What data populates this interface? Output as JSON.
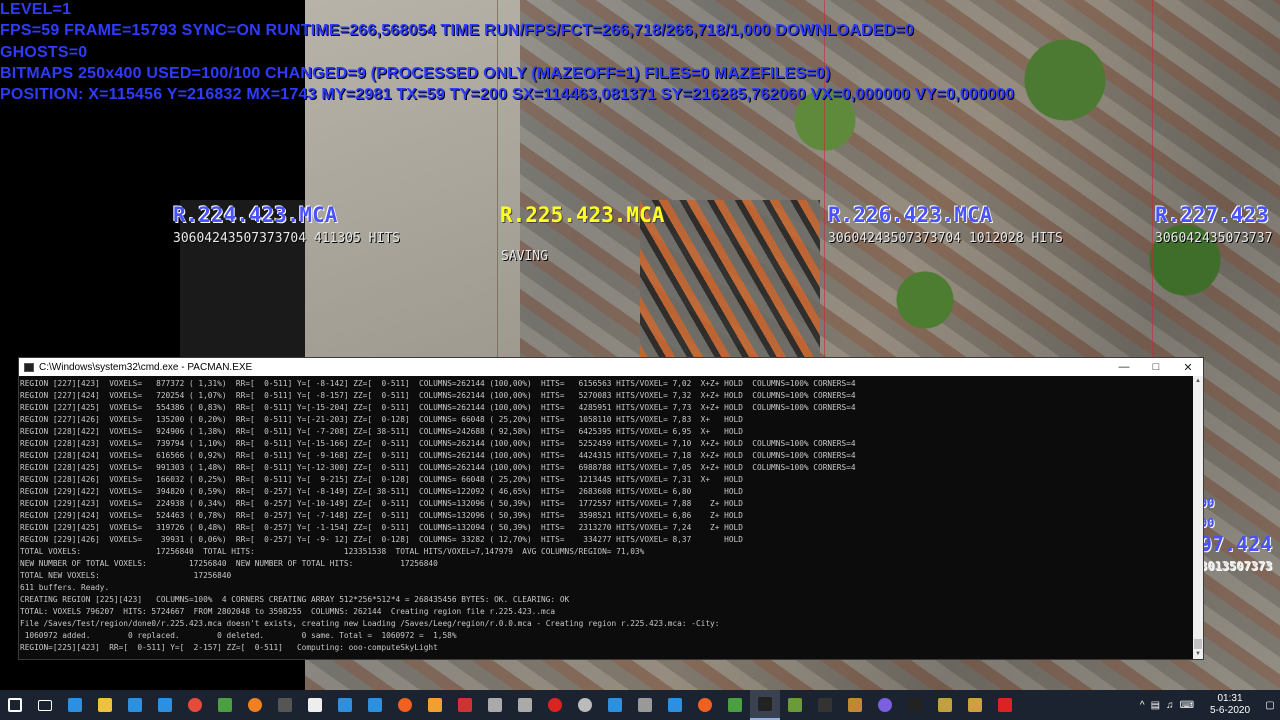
{
  "overlay": {
    "lines": [
      "LEVEL=1",
      "FPS=59 FRAME=15793 SYNC=ON RUNTIME=266,568054 TIME RUN/FPS/FCT=266,718/266,718/1,000 DOWNLOADED=0",
      "GHOSTS=0",
      "BITMAPS 250x400 USED=100/100 CHANGED=9 (PROCESSED ONLY (MAZEOFF=1) FILES=0 MAZEFILES=0)",
      "POSITION: X=115456 Y=216832 MX=1743 MY=2981 TX=59 TY=200 SX=114463,081371 SY=216285,762060 VX=0,000000 VY=0,000000"
    ],
    "color": "#2f3bff"
  },
  "regions": [
    {
      "name": "R.224.423.MCA",
      "sub": "30604243507373704  411305 HITS",
      "status": ""
    },
    {
      "name": "R.225.423.MCA",
      "sub": "",
      "status": "SAVING"
    },
    {
      "name": "R.226.423.MCA",
      "sub": "30604243507373704 1012028 HITS",
      "status": ""
    },
    {
      "name": "R.227.423",
      "sub": "306042435073737",
      "status": ""
    }
  ],
  "edge_fragments": [
    "00",
    "00",
    "97.424",
    "3013507373"
  ],
  "console": {
    "title": "C:\\Windows\\system32\\cmd.exe - PACMAN.EXE",
    "lines": [
      "REGION [227][423]  VOXELS=   877372 ( 1,31%)  RR=[  0-511] Y=[ -8-142] ZZ=[  0-511]  COLUMNS=262144 (100,00%)  HITS=   6156563 HITS/VOXEL= 7,02  X+Z+ HOLD  COLUMNS=100% CORNERS=4",
      "REGION [227][424]  VOXELS=   720254 ( 1,07%)  RR=[  0-511] Y=[ -8-157] ZZ=[  0-511]  COLUMNS=262144 (100,00%)  HITS=   5270083 HITS/VOXEL= 7,32  X+Z+ HOLD  COLUMNS=100% CORNERS=4",
      "REGION [227][425]  VOXELS=   554386 ( 0,83%)  RR=[  0-511] Y=[-15-204] ZZ=[  0-511]  COLUMNS=262144 (100,00%)  HITS=   4285951 HITS/VOXEL= 7,73  X+Z+ HOLD  COLUMNS=100% CORNERS=4",
      "REGION [227][426]  VOXELS=   135200 ( 0,20%)  RR=[  0-511] Y=[-21-203] ZZ=[  0-128]  COLUMNS= 66048 ( 25,20%)  HITS=   1058110 HITS/VOXEL= 7,83  X+   HOLD",
      "REGION [228][422]  VOXELS=   924906 ( 1,38%)  RR=[  0-511] Y=[ -7-208] ZZ=[ 38-511]  COLUMNS=242688 ( 92,58%)  HITS=   6425395 HITS/VOXEL= 6,95  X+   HOLD",
      "REGION [228][423]  VOXELS=   739794 ( 1,10%)  RR=[  0-511] Y=[-15-166] ZZ=[  0-511]  COLUMNS=262144 (100,00%)  HITS=   5252459 HITS/VOXEL= 7,10  X+Z+ HOLD  COLUMNS=100% CORNERS=4",
      "REGION [228][424]  VOXELS=   616566 ( 0,92%)  RR=[  0-511] Y=[ -9-168] ZZ=[  0-511]  COLUMNS=262144 (100,00%)  HITS=   4424315 HITS/VOXEL= 7,18  X+Z+ HOLD  COLUMNS=100% CORNERS=4",
      "REGION [228][425]  VOXELS=   991303 ( 1,48%)  RR=[  0-511] Y=[-12-300] ZZ=[  0-511]  COLUMNS=262144 (100,00%)  HITS=   6988788 HITS/VOXEL= 7,05  X+Z+ HOLD  COLUMNS=100% CORNERS=4",
      "REGION [228][426]  VOXELS=   166032 ( 0,25%)  RR=[  0-511] Y=[  9-215] ZZ=[  0-128]  COLUMNS= 66048 ( 25,20%)  HITS=   1213445 HITS/VOXEL= 7,31  X+   HOLD",
      "REGION [229][422]  VOXELS=   394820 ( 0,59%)  RR=[  0-257] Y=[ -8-149] ZZ=[ 38-511]  COLUMNS=122092 ( 46,65%)  HITS=   2683608 HITS/VOXEL= 6,80       HOLD",
      "REGION [229][423]  VOXELS=   224938 ( 0,34%)  RR=[  0-257] Y=[-10-149] ZZ=[  0-511]  COLUMNS=132096 ( 50,39%)  HITS=   1772557 HITS/VOXEL= 7,88    Z+ HOLD",
      "REGION [229][424]  VOXELS=   524463 ( 0,78%)  RR=[  0-257] Y=[ -7-148] ZZ=[  0-511]  COLUMNS=132096 ( 50,39%)  HITS=   3598521 HITS/VOXEL= 6,86    Z+ HOLD",
      "REGION [229][425]  VOXELS=   319726 ( 0,48%)  RR=[  0-257] Y=[ -1-154] ZZ=[  0-511]  COLUMNS=132094 ( 50,39%)  HITS=   2313270 HITS/VOXEL= 7,24    Z+ HOLD",
      "REGION [229][426]  VOXELS=    39931 ( 0,06%)  RR=[  0-257] Y=[ -9- 12] ZZ=[  0-128]  COLUMNS= 33282 ( 12,70%)  HITS=    334277 HITS/VOXEL= 8,37       HOLD",
      "TOTAL VOXELS:                17256840  TOTAL HITS:                   123351538  TOTAL HITS/VOXEL=7,147979  AVG COLUMNS/REGION= 71,03%",
      "NEW NUMBER OF TOTAL VOXELS:         17256840  NEW NUMBER OF TOTAL HITS:          17256840",
      "TOTAL NEW VOXELS:                    17256840",
      "611 buffers. Ready.",
      "CREATING REGION [225][423]   COLUMNS=100%  4 CORNERS CREATING ARRAY 512*256*512*4 = 268435456 BYTES: OK. CLEARING: OK",
      "TOTAL: VOXELS 796207  HITS: 5724667  FROM 2802048 to 3598255  COLUMNS: 262144  Creating region file r.225.423..mca",
      "File /Saves/Test/region/done0/r.225.423.mca doesn't exists, creating new Loading /Saves/Leeg/region/r.0.0.mca - Creating region r.225.423.mca: -City:",
      " 1060972 added.        0 replaced.        0 deleted.        0 same. Total =  1060972 =  1,58%",
      "REGION=[225][423]  RR=[  0-511] Y=[  2-157] ZZ=[  0-511]   Computing: ooo-computeSkyLight"
    ]
  },
  "taskbar": {
    "icons": [
      "windows-start-icon",
      "task-view-icon",
      "edge-icon",
      "file-explorer-icon",
      "store-icon",
      "mail-icon",
      "chrome-icon",
      "notepad-icon",
      "vlc-icon",
      "terminal-icon",
      "github-icon",
      "edge-blue-icon",
      "photos-icon",
      "firefox-icon",
      "paint-icon",
      "tool-icon",
      "steam-icon",
      "settings-icon",
      "record-icon",
      "obs-icon",
      "globe-icon",
      "calculator-icon",
      "maps-icon",
      "ubuntu-icon",
      "sound-icon",
      "cmd-icon",
      "minecraft-icon",
      "console-icon",
      "archive-icon",
      "discord-icon",
      "terminal2-icon",
      "cube-icon",
      "box-icon",
      "filezilla-icon",
      "vs-icon",
      "window-icon"
    ],
    "colors": [
      "#ffffff",
      "#ffffff",
      "#2d8fe0",
      "#f0c040",
      "#2d8fe0",
      "#2d8fe0",
      "#e84a3a",
      "#4aa040",
      "#f08020",
      "#555555",
      "#eeeeee",
      "#2d8fe0",
      "#2d8fe0",
      "#f06020",
      "#f0a030",
      "#cc3333",
      "#aaaaaa",
      "#aaaaaa",
      "#dd2222",
      "#bbbbbb",
      "#2d8fe0",
      "#999999",
      "#2d8fe0",
      "#f06020",
      "#4aa040",
      "#222222",
      "#6a9a3a",
      "#333333",
      "#c08830",
      "#7a60e0",
      "#222222",
      "#c0a040",
      "#d0a040",
      "#dd2222",
      "#5070e0",
      "#cccccc"
    ],
    "time": "01:31",
    "date": "5-6-2020"
  }
}
